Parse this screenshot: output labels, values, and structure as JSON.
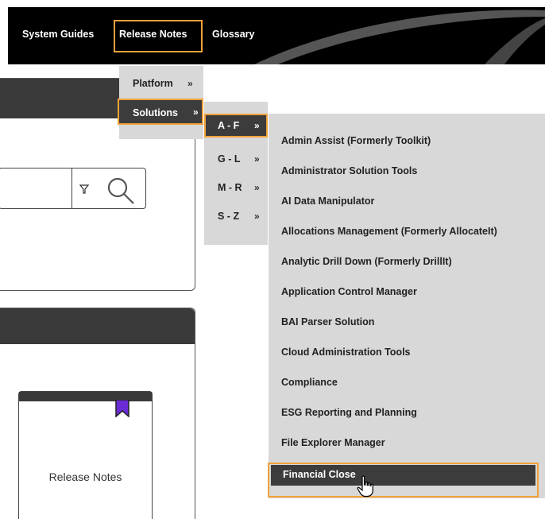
{
  "nav": {
    "system_guides": "System Guides",
    "release_notes": "Release Notes",
    "glossary": "Glossary"
  },
  "menu_level1": {
    "items": [
      {
        "label": "Platform",
        "chevron": "»"
      },
      {
        "label": "Solutions",
        "chevron": "»"
      }
    ]
  },
  "menu_level2": {
    "items": [
      {
        "label": "A - F",
        "chevron": "»"
      },
      {
        "label": "G - L",
        "chevron": "»"
      },
      {
        "label": "M - R",
        "chevron": "»"
      },
      {
        "label": "S - Z",
        "chevron": "»"
      }
    ]
  },
  "menu_level3": {
    "items": [
      "Admin Assist (Formerly Toolkit)",
      "Administrator Solution Tools",
      "AI Data Manipulator",
      "Allocations Management (Formerly AllocateIt)",
      "Analytic Drill Down (Formerly DrillIt)",
      "Application Control Manager",
      "BAI Parser Solution",
      "Cloud Administration Tools",
      "Compliance",
      "ESG Reporting and Planning",
      "File Explorer Manager",
      "Financial Close"
    ]
  },
  "card": {
    "label": "Release Notes"
  },
  "colors": {
    "highlight": "#f0a13a",
    "menu_bg": "#d8d8d8",
    "active_bg": "#3c3c3c",
    "bookmark": "#6a2bd4"
  }
}
